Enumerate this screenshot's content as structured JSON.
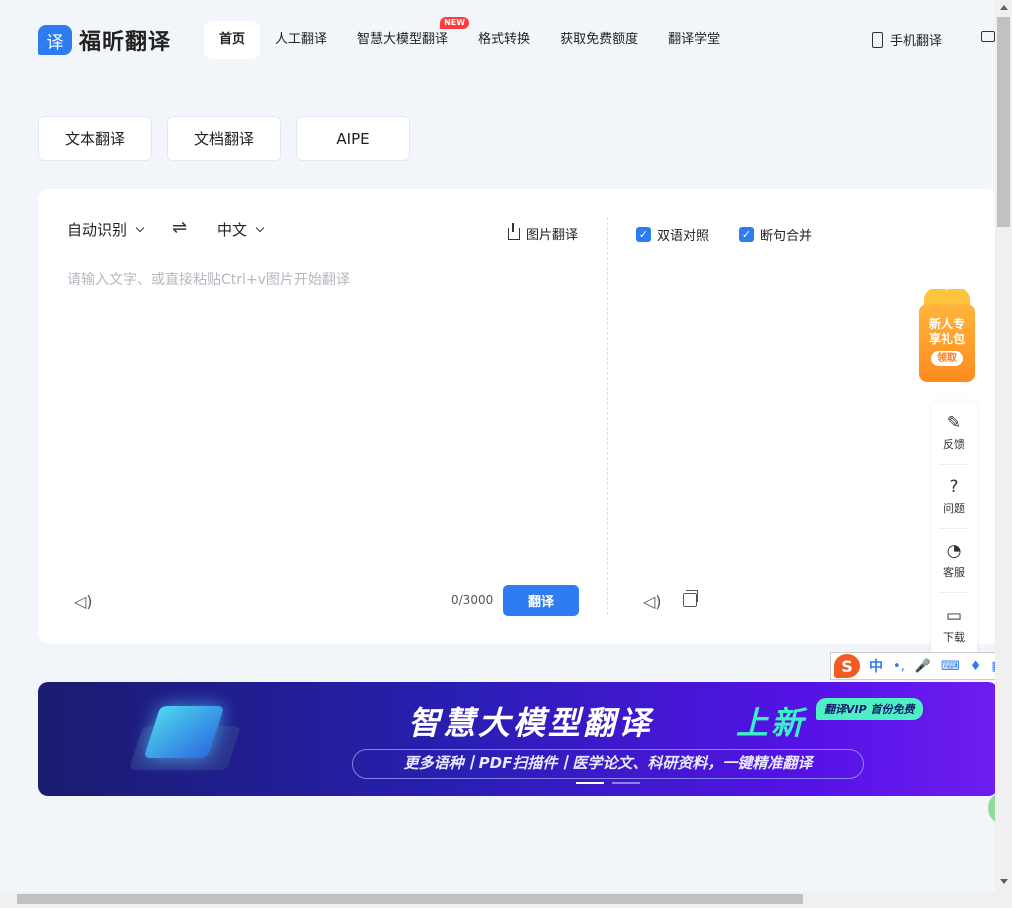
{
  "header": {
    "logo_badge": "译",
    "logo_text": "福昕翻译",
    "nav": [
      {
        "label": "首页",
        "active": true
      },
      {
        "label": "人工翻译"
      },
      {
        "label": "智慧大模型翻译",
        "badge": "NEW"
      },
      {
        "label": "格式转换"
      },
      {
        "label": "获取免费额度"
      },
      {
        "label": "翻译学堂"
      }
    ],
    "mobile_label": "手机翻译"
  },
  "modes": [
    "文本翻译",
    "文档翻译",
    "AIPE"
  ],
  "translator": {
    "source_lang": "自动识别",
    "target_lang": "中文",
    "swap_icon": "⇌",
    "image_translate": "图片翻译",
    "placeholder": "请输入文字、或直接粘贴Ctrl+v图片开始翻译",
    "count": "0/3000",
    "translate_button": "翻译",
    "options": [
      {
        "label": "双语对照",
        "checked": true
      },
      {
        "label": "断句合并",
        "checked": true
      }
    ]
  },
  "gift": {
    "line1": "新人专",
    "line2": "享礼包",
    "button": "领取"
  },
  "sidebar": [
    {
      "label": "反馈",
      "icon": "✎"
    },
    {
      "label": "问题",
      "icon": "?"
    },
    {
      "label": "客服",
      "icon": "◔"
    },
    {
      "label": "下载",
      "icon": "▭"
    }
  ],
  "ime": {
    "logo": "S",
    "mode": "中",
    "punct": "•,"
  },
  "banner": {
    "title": "智慧大模型翻译",
    "title_new": "上新",
    "vip_tag": "翻译VIP 首份免费",
    "subtitle": "更多语种丨PDF扫描件丨医学论文、科研资料，一键精准翻译"
  },
  "colors": {
    "accent": "#2d7cf0",
    "gift": "#ff8a1d",
    "banner_new": "#3cf0c6"
  }
}
